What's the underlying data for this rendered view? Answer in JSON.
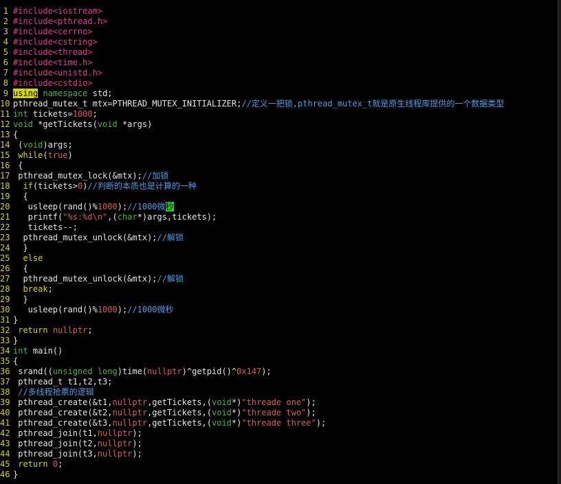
{
  "editor": {
    "lines": [
      {
        "n": "1",
        "tokens": [
          {
            "t": "#include<iostream>",
            "c": "p"
          }
        ]
      },
      {
        "n": "2",
        "tokens": [
          {
            "t": "#include<pthread.h>",
            "c": "p"
          }
        ]
      },
      {
        "n": "3",
        "tokens": [
          {
            "t": "#include<cerrno>",
            "c": "p"
          }
        ]
      },
      {
        "n": "4",
        "tokens": [
          {
            "t": "#include<cstring>",
            "c": "p"
          }
        ]
      },
      {
        "n": "5",
        "tokens": [
          {
            "t": "#include<thread>",
            "c": "p"
          }
        ]
      },
      {
        "n": "6",
        "tokens": [
          {
            "t": "#include<time.h>",
            "c": "p"
          }
        ]
      },
      {
        "n": "7",
        "tokens": [
          {
            "t": "#include<unistd.h>",
            "c": "p"
          }
        ]
      },
      {
        "n": "8",
        "tokens": [
          {
            "t": "#include<cstdio>",
            "c": "p"
          }
        ]
      },
      {
        "n": "9",
        "tokens": [
          {
            "t": "using",
            "c": "hl-y"
          },
          {
            "t": " ",
            "c": "d"
          },
          {
            "t": "namespace",
            "c": "k"
          },
          {
            "t": " std;",
            "c": "d"
          }
        ]
      },
      {
        "n": "10",
        "tokens": [
          {
            "t": "pthread_mutex_t mtx=PTHREAD_MUTEX_INITIALIZER;",
            "c": "d"
          },
          {
            "t": "//定义一把锁,pthread_mutex_t就是原生线程库提供的一个数据类型",
            "c": "c"
          }
        ]
      },
      {
        "n": "11",
        "tokens": [
          {
            "t": "int",
            "c": "k"
          },
          {
            "t": " tickets=",
            "c": "d"
          },
          {
            "t": "1000",
            "c": "n"
          },
          {
            "t": ";",
            "c": "d"
          }
        ]
      },
      {
        "n": "12",
        "tokens": [
          {
            "t": "void",
            "c": "k"
          },
          {
            "t": " *getTickets(",
            "c": "d"
          },
          {
            "t": "void",
            "c": "k"
          },
          {
            "t": " *args)",
            "c": "d"
          }
        ]
      },
      {
        "n": "13",
        "tokens": [
          {
            "t": "{",
            "c": "d"
          }
        ]
      },
      {
        "n": "14",
        "tokens": [
          {
            "t": " (",
            "c": "d"
          },
          {
            "t": "void",
            "c": "k"
          },
          {
            "t": ")args;",
            "c": "d"
          }
        ]
      },
      {
        "n": "15",
        "tokens": [
          {
            "t": " ",
            "c": "d"
          },
          {
            "t": "while",
            "c": "y"
          },
          {
            "t": "(",
            "c": "d"
          },
          {
            "t": "true",
            "c": "n"
          },
          {
            "t": ")",
            "c": "d"
          }
        ]
      },
      {
        "n": "16",
        "tokens": [
          {
            "t": " {",
            "c": "d"
          }
        ]
      },
      {
        "n": "17",
        "tokens": [
          {
            "t": " pthread_mutex_lock(&mtx);",
            "c": "d"
          },
          {
            "t": "//加锁",
            "c": "c"
          }
        ]
      },
      {
        "n": "18",
        "tokens": [
          {
            "t": "  ",
            "c": "d"
          },
          {
            "t": "if",
            "c": "y"
          },
          {
            "t": "(tickets>",
            "c": "d"
          },
          {
            "t": "0",
            "c": "n"
          },
          {
            "t": ")",
            "c": "d"
          },
          {
            "t": "//判断的本质也是计算的一种",
            "c": "c"
          }
        ]
      },
      {
        "n": "19",
        "tokens": [
          {
            "t": "  {",
            "c": "d"
          }
        ]
      },
      {
        "n": "20",
        "tokens": [
          {
            "t": "   usleep(rand()%",
            "c": "d"
          },
          {
            "t": "1000",
            "c": "n"
          },
          {
            "t": ");",
            "c": "d"
          },
          {
            "t": "//1000微",
            "c": "c"
          },
          {
            "t": "秒",
            "c": "hl-g"
          }
        ]
      },
      {
        "n": "21",
        "tokens": [
          {
            "t": "   printf(",
            "c": "d"
          },
          {
            "t": "\"%s:%d\\n\"",
            "c": "s"
          },
          {
            "t": ",(",
            "c": "d"
          },
          {
            "t": "char",
            "c": "k"
          },
          {
            "t": "*)args,tickets);",
            "c": "d"
          }
        ]
      },
      {
        "n": "22",
        "tokens": [
          {
            "t": "   tickets--;",
            "c": "d"
          }
        ]
      },
      {
        "n": "23",
        "tokens": [
          {
            "t": "  pthread_mutex_unlock(&mtx);",
            "c": "d"
          },
          {
            "t": "//解锁",
            "c": "c"
          }
        ]
      },
      {
        "n": "24",
        "tokens": [
          {
            "t": "  }",
            "c": "d"
          }
        ]
      },
      {
        "n": "25",
        "tokens": [
          {
            "t": "  ",
            "c": "d"
          },
          {
            "t": "else",
            "c": "y"
          }
        ]
      },
      {
        "n": "26",
        "tokens": [
          {
            "t": "  {",
            "c": "d"
          }
        ]
      },
      {
        "n": "27",
        "tokens": [
          {
            "t": "  pthread_mutex_unlock(&mtx);",
            "c": "d"
          },
          {
            "t": "//解锁",
            "c": "c"
          }
        ]
      },
      {
        "n": "28",
        "tokens": [
          {
            "t": "  ",
            "c": "d"
          },
          {
            "t": "break",
            "c": "y"
          },
          {
            "t": ";",
            "c": "d"
          }
        ]
      },
      {
        "n": "29",
        "tokens": [
          {
            "t": "  }",
            "c": "d"
          }
        ]
      },
      {
        "n": "30",
        "tokens": [
          {
            "t": "   usleep(rand()%",
            "c": "d"
          },
          {
            "t": "1000",
            "c": "n"
          },
          {
            "t": ");",
            "c": "d"
          },
          {
            "t": "//1000微秒",
            "c": "c"
          }
        ]
      },
      {
        "n": "31",
        "tokens": [
          {
            "t": "}",
            "c": "d"
          }
        ]
      },
      {
        "n": "32",
        "tokens": [
          {
            "t": " ",
            "c": "d"
          },
          {
            "t": "return",
            "c": "y"
          },
          {
            "t": " ",
            "c": "d"
          },
          {
            "t": "nullptr",
            "c": "n"
          },
          {
            "t": ";",
            "c": "d"
          }
        ]
      },
      {
        "n": "33",
        "tokens": [
          {
            "t": "}",
            "c": "d"
          }
        ]
      },
      {
        "n": "34",
        "tokens": [
          {
            "t": "int",
            "c": "k"
          },
          {
            "t": " main()",
            "c": "d"
          }
        ]
      },
      {
        "n": "35",
        "tokens": [
          {
            "t": "{",
            "c": "d"
          }
        ]
      },
      {
        "n": "36",
        "tokens": [
          {
            "t": " srand((",
            "c": "d"
          },
          {
            "t": "unsigned long",
            "c": "k"
          },
          {
            "t": ")time(",
            "c": "d"
          },
          {
            "t": "nullptr",
            "c": "n"
          },
          {
            "t": ")^getpid()^",
            "c": "d"
          },
          {
            "t": "0x147",
            "c": "n"
          },
          {
            "t": ");",
            "c": "d"
          }
        ]
      },
      {
        "n": "37",
        "tokens": [
          {
            "t": " pthread_t t1,t2,t3;",
            "c": "d"
          }
        ]
      },
      {
        "n": "38",
        "tokens": [
          {
            "t": " ",
            "c": "d"
          },
          {
            "t": "//多线程抢票的逻辑",
            "c": "c"
          }
        ]
      },
      {
        "n": "39",
        "tokens": [
          {
            "t": " pthread_create(&t1,",
            "c": "d"
          },
          {
            "t": "nullptr",
            "c": "n"
          },
          {
            "t": ",getTickets,(",
            "c": "d"
          },
          {
            "t": "void",
            "c": "k"
          },
          {
            "t": "*)",
            "c": "d"
          },
          {
            "t": "\"threade one\"",
            "c": "s"
          },
          {
            "t": ");",
            "c": "d"
          }
        ]
      },
      {
        "n": "40",
        "tokens": [
          {
            "t": " pthread_create(&t2,",
            "c": "d"
          },
          {
            "t": "nullptr",
            "c": "n"
          },
          {
            "t": ",getTickets,(",
            "c": "d"
          },
          {
            "t": "void",
            "c": "k"
          },
          {
            "t": "*)",
            "c": "d"
          },
          {
            "t": "\"threade two\"",
            "c": "s"
          },
          {
            "t": ");",
            "c": "d"
          }
        ]
      },
      {
        "n": "41",
        "tokens": [
          {
            "t": " pthread_create(&t3,",
            "c": "d"
          },
          {
            "t": "nullptr",
            "c": "n"
          },
          {
            "t": ",getTickets,(",
            "c": "d"
          },
          {
            "t": "void",
            "c": "k"
          },
          {
            "t": "*)",
            "c": "d"
          },
          {
            "t": "\"threade three\"",
            "c": "s"
          },
          {
            "t": ");",
            "c": "d"
          }
        ]
      },
      {
        "n": "42",
        "tokens": [
          {
            "t": " pthread_join(t1,",
            "c": "d"
          },
          {
            "t": "nullptr",
            "c": "n"
          },
          {
            "t": ");",
            "c": "d"
          }
        ]
      },
      {
        "n": "43",
        "tokens": [
          {
            "t": " pthread_join(t2,",
            "c": "d"
          },
          {
            "t": "nullptr",
            "c": "n"
          },
          {
            "t": ");",
            "c": "d"
          }
        ]
      },
      {
        "n": "44",
        "tokens": [
          {
            "t": " pthread_join(t3,",
            "c": "d"
          },
          {
            "t": "nullptr",
            "c": "n"
          },
          {
            "t": ");",
            "c": "d"
          }
        ]
      },
      {
        "n": "45",
        "tokens": [
          {
            "t": " ",
            "c": "d"
          },
          {
            "t": "return",
            "c": "y"
          },
          {
            "t": " ",
            "c": "d"
          },
          {
            "t": "0",
            "c": "n"
          },
          {
            "t": ";",
            "c": "d"
          }
        ]
      },
      {
        "n": "46",
        "tokens": [
          {
            "t": "}",
            "c": "d"
          }
        ]
      }
    ]
  }
}
